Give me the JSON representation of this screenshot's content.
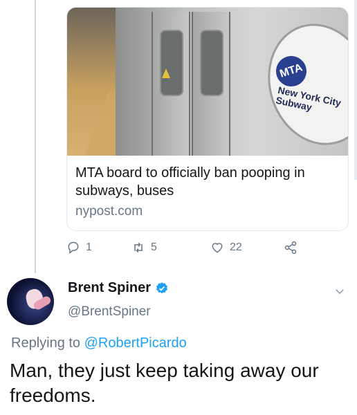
{
  "card": {
    "image_text": {
      "logo": "MTA",
      "line1": "New York City",
      "line2": "Subway"
    },
    "title": "MTA board to officially ban pooping in subways, buses",
    "domain": "nypost.com"
  },
  "actions": {
    "reply": {
      "icon": "reply-icon",
      "count": "1"
    },
    "retweet": {
      "icon": "retweet-icon",
      "count": "5"
    },
    "like": {
      "icon": "heart-icon",
      "count": "22"
    },
    "share": {
      "icon": "share-icon"
    }
  },
  "author": {
    "name": "Brent Spiner",
    "handle": "@BrentSpiner",
    "verified": true
  },
  "reply": {
    "prefix": "Replying to",
    "mention": "@RobertPicardo"
  },
  "tweet": {
    "text": "Man, they just keep taking away our freedoms."
  },
  "colors": {
    "accent": "#1da1f2",
    "muted": "#657786",
    "text": "#14171a",
    "border": "#e1e8ed"
  }
}
